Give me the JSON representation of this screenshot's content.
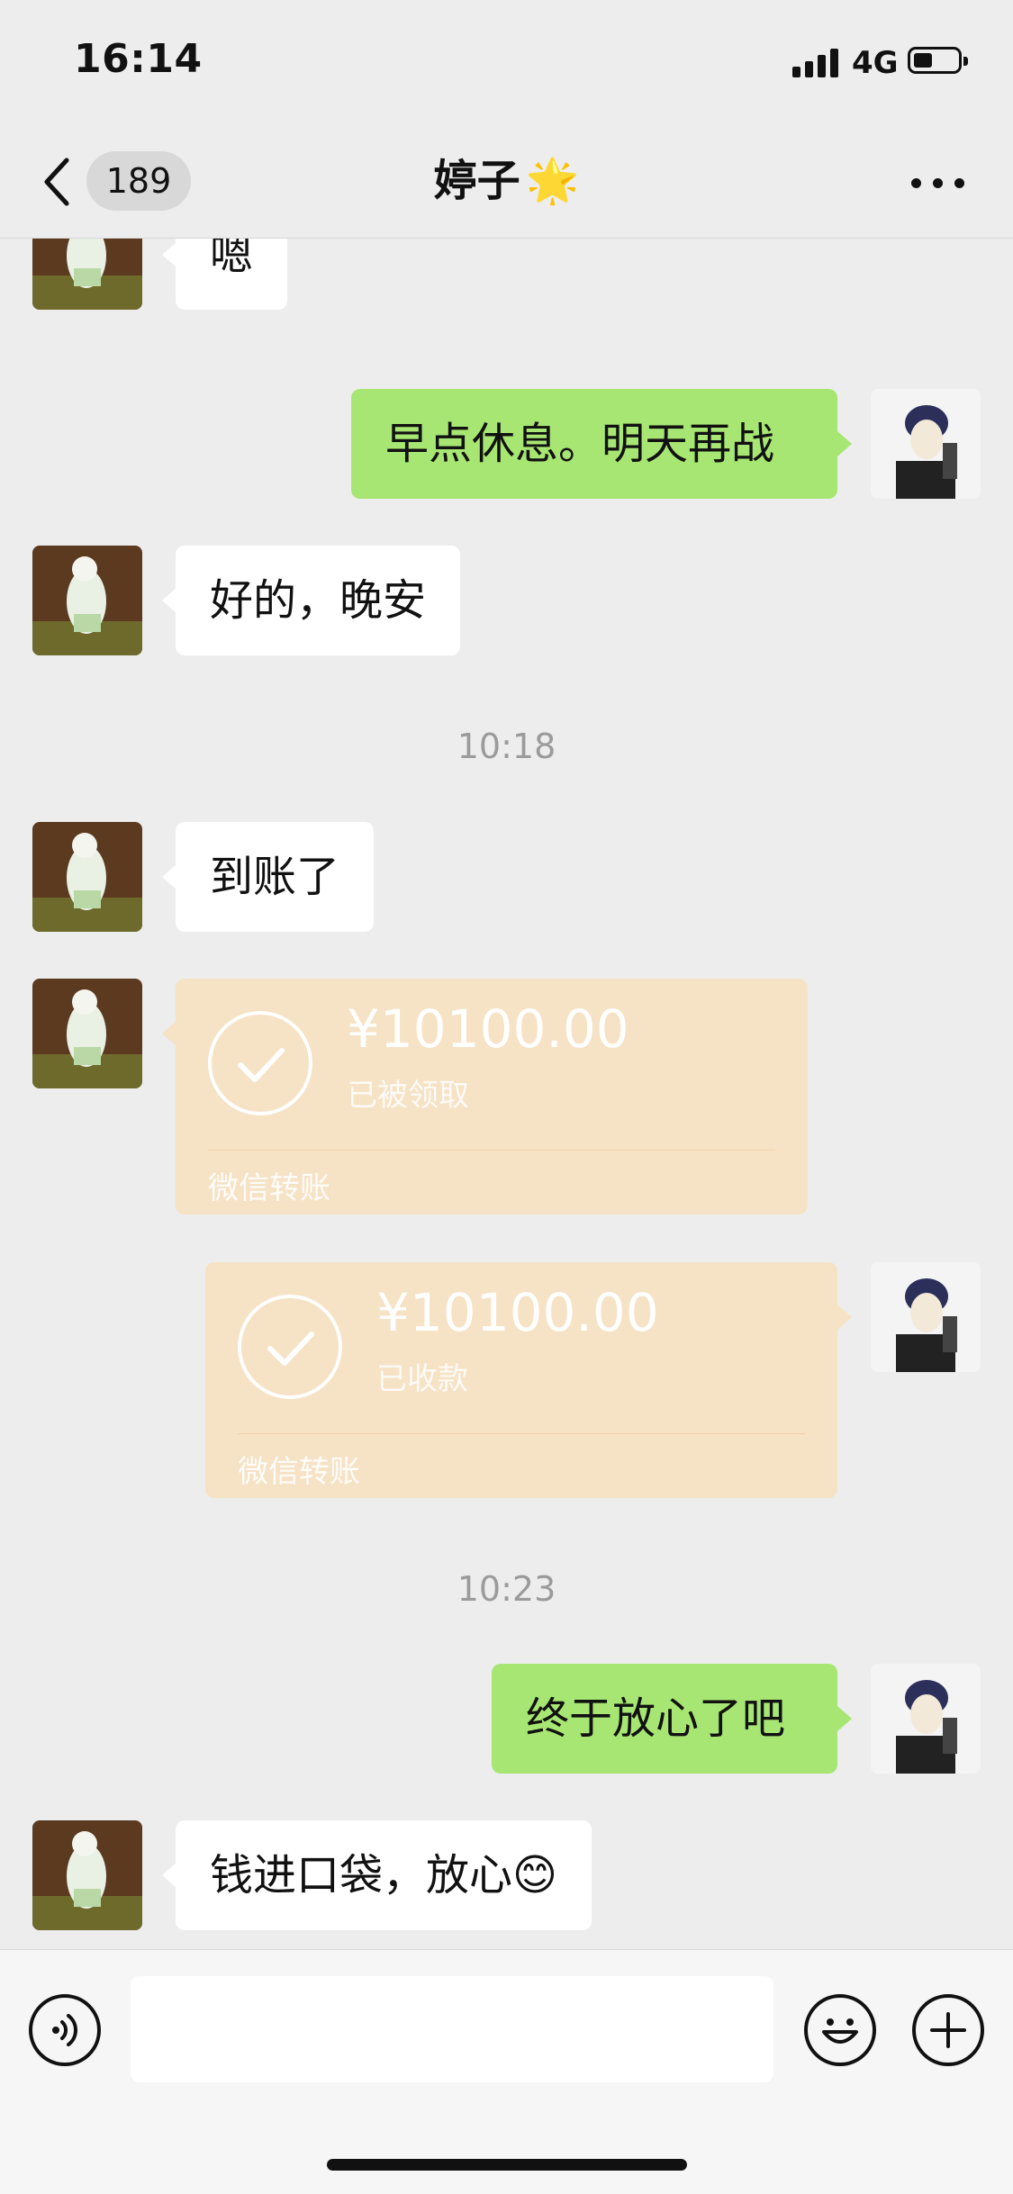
{
  "status_bar": {
    "time": "16:14",
    "network": "4G"
  },
  "nav": {
    "unread_count": "189",
    "title": "婷子",
    "title_emoji": "🌟"
  },
  "messages": [
    {
      "from": "other",
      "text": "嗯"
    },
    {
      "from": "me",
      "text": "早点休息。明天再战"
    },
    {
      "from": "other",
      "text": "好的，晚安"
    },
    {
      "type": "timestamp",
      "text": "10:18"
    },
    {
      "from": "other",
      "text": "到账了"
    },
    {
      "from": "other",
      "type": "transfer",
      "amount": "¥10100.00",
      "status": "已被领取",
      "footer": "微信转账"
    },
    {
      "from": "me",
      "type": "transfer",
      "amount": "¥10100.00",
      "status": "已收款",
      "footer": "微信转账"
    },
    {
      "type": "timestamp",
      "text": "10:23"
    },
    {
      "from": "me",
      "text": "终于放心了吧"
    },
    {
      "from": "other",
      "text": "钱进口袋，放心😊"
    }
  ],
  "input": {
    "value": "",
    "placeholder": ""
  },
  "icons": {
    "back": "chevron-left-icon",
    "more": "more-dots-icon",
    "voice": "voice-icon",
    "emoji": "emoji-icon",
    "add": "add-icon",
    "transfer_check": "check-icon"
  },
  "colors": {
    "background": "#ededed",
    "my_bubble": "#a7e672",
    "their_bubble": "#ffffff",
    "transfer_card": "#f6e2c5"
  }
}
